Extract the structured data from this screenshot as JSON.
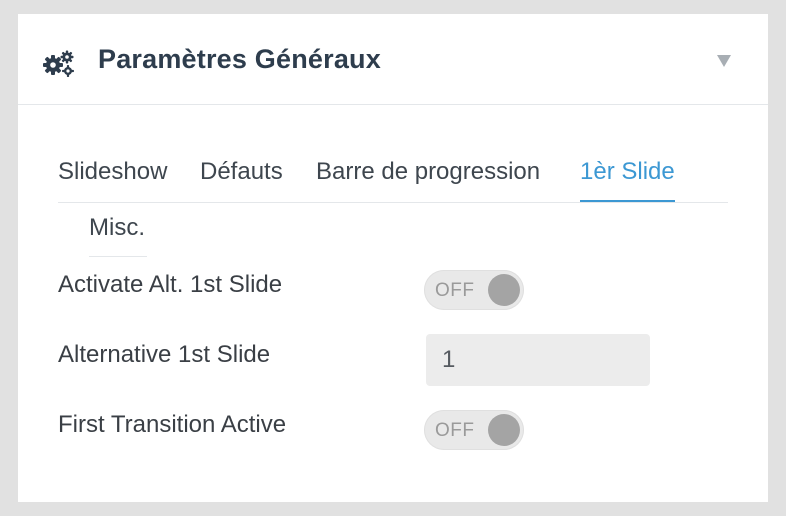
{
  "panel": {
    "title": "Paramètres Généraux",
    "icon": "gears-icon",
    "collapse_icon": "caret-down-icon"
  },
  "tabs": [
    {
      "label": "Slideshow",
      "active": false
    },
    {
      "label": "Défauts",
      "active": false
    },
    {
      "label": "Barre de progression",
      "active": false
    },
    {
      "label": "1èr Slide",
      "active": true
    },
    {
      "label": "Misc.",
      "active": false
    }
  ],
  "fields": {
    "activate_alt_first_slide": {
      "label": "Activate Alt. 1st Slide",
      "state": "OFF"
    },
    "alternative_first_slide": {
      "label": "Alternative 1st Slide",
      "value": "1"
    },
    "first_transition_active": {
      "label": "First Transition Active",
      "state": "OFF"
    }
  },
  "colors": {
    "accent": "#3c98d3",
    "title": "#2e3d4d",
    "background": "#e1e1e1",
    "panel": "#ffffff"
  }
}
